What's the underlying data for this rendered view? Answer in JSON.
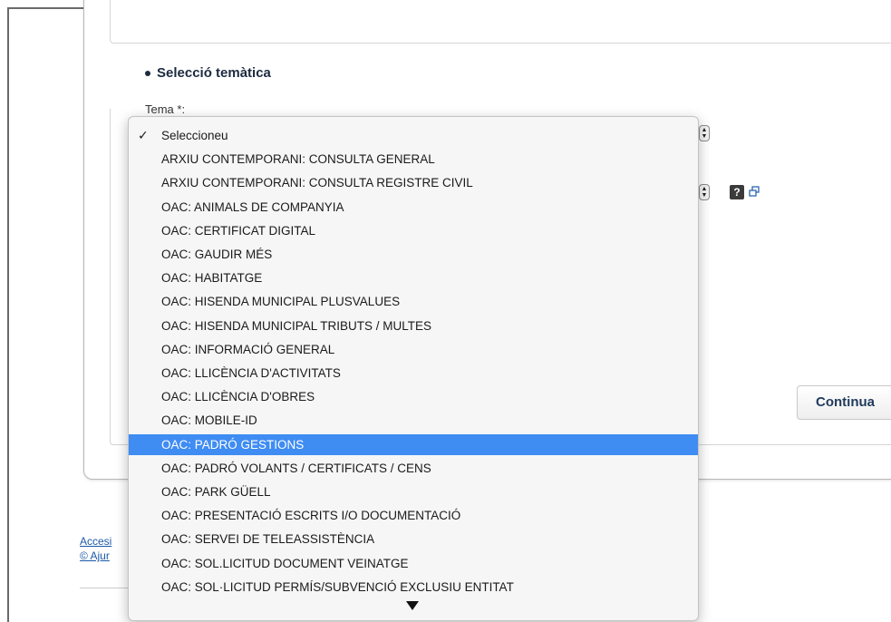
{
  "section": {
    "title": "Selecció temàtica",
    "tema_label": "Tema *:"
  },
  "dropdown": {
    "selected_value": "Seleccioneu",
    "highlighted_option": "OAC: PADRÓ GESTIONS",
    "options": [
      "Seleccioneu",
      "ARXIU CONTEMPORANI: CONSULTA GENERAL",
      "ARXIU CONTEMPORANI: CONSULTA REGISTRE CIVIL",
      "OAC: ANIMALS DE COMPANYIA",
      "OAC: CERTIFICAT DIGITAL",
      "OAC: GAUDIR MÉS",
      "OAC: HABITATGE",
      "OAC: HISENDA MUNICIPAL PLUSVALUES",
      "OAC: HISENDA MUNICIPAL TRIBUTS / MULTES",
      "OAC: INFORMACIÓ GENERAL",
      "OAC: LLICÈNCIA D'ACTIVITATS",
      "OAC: LLICÈNCIA D'OBRES",
      "OAC: MOBILE-ID",
      "OAC: PADRÓ GESTIONS",
      "OAC: PADRÓ VOLANTS / CERTIFICATS / CENS",
      "OAC: PARK GÜELL",
      "OAC: PRESENTACIÓ ESCRITS I/O DOCUMENTACIÓ",
      "OAC: SERVEI DE TELEASSISTÈNCIA",
      "OAC: SOL.LICITUD DOCUMENT VEINATGE",
      "OAC: SOL·LICITUD PERMÍS/SUBVENCIÓ EXCLUSIU ENTITAT"
    ],
    "checkmark": "✓",
    "highlight_color": "#3f8cf3",
    "scroll_indicator_icon": "triangle-down"
  },
  "buttons": {
    "continue_label": "Continua"
  },
  "help": {
    "label": "?"
  },
  "footer": {
    "link1": "Accesi",
    "link2": "© Ajur"
  },
  "colors": {
    "title_color": "#1c2b3f",
    "link_color": "#1d5aa8",
    "continue_text": "#1f3a5c"
  }
}
